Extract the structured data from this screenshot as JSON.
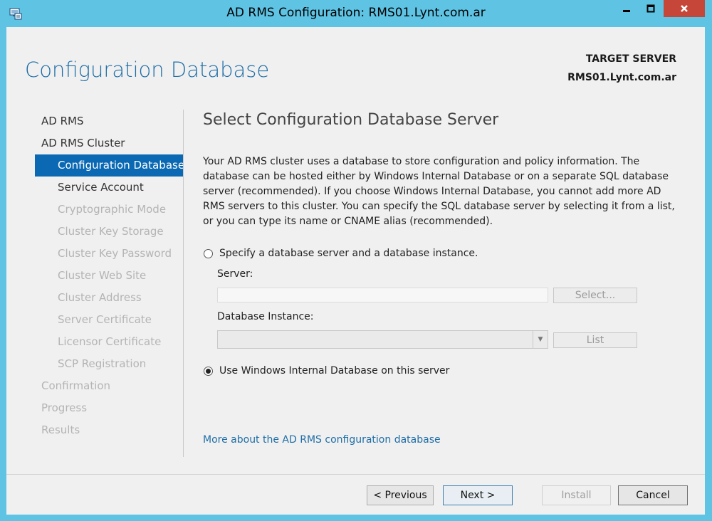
{
  "window": {
    "title": "AD RMS Configuration: RMS01.Lynt.com.ar"
  },
  "header": {
    "page_title": "Configuration Database",
    "target_server_label": "TARGET SERVER",
    "target_server_value": "RMS01.Lynt.com.ar"
  },
  "nav": {
    "items": [
      {
        "label": "AD RMS",
        "level": 1,
        "state": "enabled"
      },
      {
        "label": "AD RMS Cluster",
        "level": 1,
        "state": "enabled"
      },
      {
        "label": "Configuration Database",
        "level": 2,
        "state": "selected"
      },
      {
        "label": "Service Account",
        "level": 2,
        "state": "enabled"
      },
      {
        "label": "Cryptographic Mode",
        "level": 2,
        "state": "disabled"
      },
      {
        "label": "Cluster Key Storage",
        "level": 2,
        "state": "disabled"
      },
      {
        "label": "Cluster Key Password",
        "level": 2,
        "state": "disabled"
      },
      {
        "label": "Cluster Web Site",
        "level": 2,
        "state": "disabled"
      },
      {
        "label": "Cluster Address",
        "level": 2,
        "state": "disabled"
      },
      {
        "label": "Server Certificate",
        "level": 2,
        "state": "disabled"
      },
      {
        "label": "Licensor Certificate",
        "level": 2,
        "state": "disabled"
      },
      {
        "label": "SCP Registration",
        "level": 2,
        "state": "disabled"
      },
      {
        "label": "Confirmation",
        "level": 1,
        "state": "disabled"
      },
      {
        "label": "Progress",
        "level": 1,
        "state": "disabled"
      },
      {
        "label": "Results",
        "level": 1,
        "state": "disabled"
      }
    ]
  },
  "main": {
    "section_title": "Select Configuration Database Server",
    "description": "Your AD RMS cluster uses a database to store configuration and policy information. The database can be hosted either by Windows Internal Database or on a separate SQL database server (recommended). If you choose Windows Internal Database, you cannot add more AD RMS servers to this cluster. You can specify the SQL database server by selecting it from a list, or you can type its name or CNAME alias (recommended).",
    "option_sql_label": "Specify a database server and a database instance.",
    "option_sql_checked": false,
    "server_label": "Server:",
    "server_value": "",
    "select_button": "Select...",
    "instance_label": "Database Instance:",
    "instance_value": "",
    "list_button": "List",
    "option_wid_label": "Use Windows Internal Database on this server",
    "option_wid_checked": true,
    "more_link": "More about the AD RMS configuration database"
  },
  "footer": {
    "previous": "< Previous",
    "next": "Next >",
    "install": "Install",
    "cancel": "Cancel"
  },
  "colors": {
    "accent": "#1e6ea7",
    "selected_nav": "#0b69b3",
    "frame": "#5fc3e4",
    "close_button": "#c7463a"
  }
}
